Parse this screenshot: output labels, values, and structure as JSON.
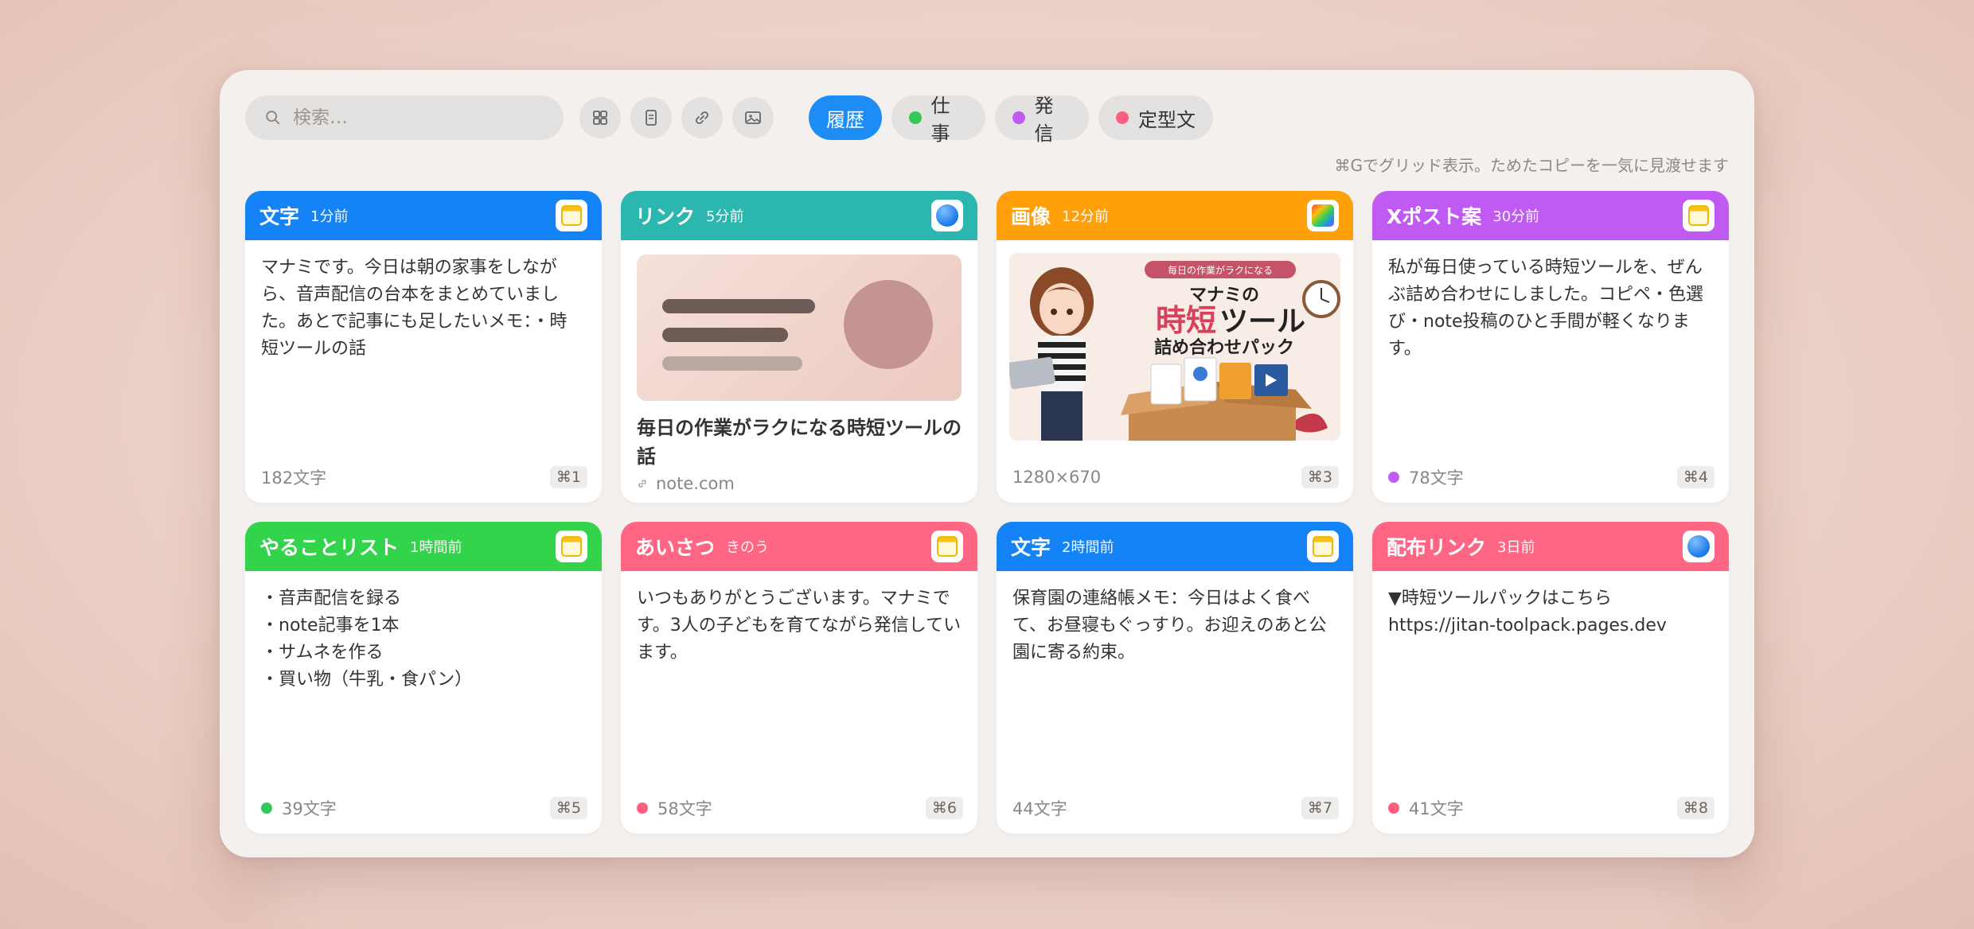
{
  "search": {
    "placeholder": "検索…"
  },
  "toolbar": {
    "icons": [
      "grid-icon",
      "text-icon",
      "link-icon",
      "image-icon"
    ]
  },
  "filters": [
    {
      "label": "履歴",
      "active": true,
      "color": ""
    },
    {
      "label": "仕事",
      "active": false,
      "color": "#34c759"
    },
    {
      "label": "発信",
      "active": false,
      "color": "#bf5af2"
    },
    {
      "label": "定型文",
      "active": false,
      "color": "#ff5f7e"
    }
  ],
  "hint": "⌘Gでグリッド表示。ためたコピーを一気に見渡せます",
  "cards": [
    {
      "type": "文字",
      "time": "1分前",
      "header_color": "#1483f5",
      "app_icon": "notes-icon",
      "body": "マナミです。今日は朝の家事をしなが\nら、音声配信の台本をまとめていまし\nた。あとで記事にも足したいメモ：・時\n短ツールの話",
      "footer": "182文字",
      "dot_color": "",
      "shortcut": "⌘1"
    },
    {
      "type": "リンク",
      "time": "5分前",
      "header_color": "#2bb7b0",
      "app_icon": "globe-icon",
      "link_title": "毎日の作業がラクになる時短ツールの\n話",
      "footer": "note.com",
      "shortcut": ""
    },
    {
      "type": "画像",
      "time": "12分前",
      "header_color": "#ff9f0a",
      "app_icon": "photos-icon",
      "image": {
        "banner": "毎日の作業がラクになる",
        "line1": "マナミの",
        "line2a": "時短",
        "line2b": "ツール",
        "line3": "詰め合わせパック"
      },
      "footer": "1280×670",
      "dot_color": "",
      "shortcut": "⌘3"
    },
    {
      "type": "Xポスト案",
      "time": "30分前",
      "header_color": "#bf5af2",
      "app_icon": "notes-icon",
      "body": "私が毎日使っている時短ツールを、ぜん\nぶ詰め合わせにしました。コピペ・色選\nび・note投稿のひと手間が軽くなりま\nす。",
      "footer": "78文字",
      "dot_color": "#bf5af2",
      "shortcut": "⌘4"
    },
    {
      "type": "やることリスト",
      "time": "1時間前",
      "header_color": "#34d34c",
      "app_icon": "notes-icon",
      "body": "・音声配信を録る\n・note記事を1本\n・サムネを作る\n・買い物（牛乳・食パン）",
      "footer": "39文字",
      "dot_color": "#34c759",
      "shortcut": "⌘5"
    },
    {
      "type": "あいさつ",
      "time": "きのう",
      "header_color": "#ff6683",
      "app_icon": "notes-icon",
      "body": "いつもありがとうございます。マナミで\nす。3人の子どもを育てながら発信してい\nます。",
      "footer": "58文字",
      "dot_color": "#ff5f7e",
      "shortcut": "⌘6"
    },
    {
      "type": "文字",
      "time": "2時間前",
      "header_color": "#1483f5",
      "app_icon": "notes-icon",
      "body": "保育園の連絡帳メモ：今日はよく食べ\nて、お昼寝もぐっすり。お迎えのあと公\n園に寄る約束。",
      "footer": "44文字",
      "dot_color": "",
      "shortcut": "⌘7"
    },
    {
      "type": "配布リンク",
      "time": "3日前",
      "header_color": "#ff6683",
      "app_icon": "globe-icon",
      "body": "▼時短ツールパックはこちら\nhttps://jitan-toolpack.pages.dev",
      "footer": "41文字",
      "dot_color": "#ff5f7e",
      "shortcut": "⌘8"
    }
  ]
}
